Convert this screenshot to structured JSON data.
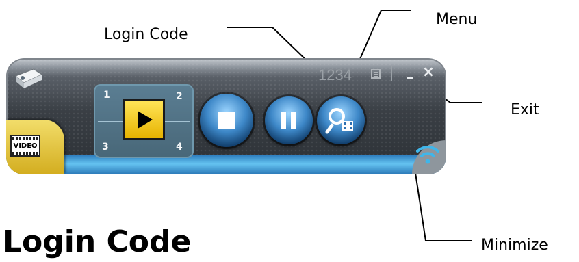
{
  "callouts": {
    "login_code": "Login Code",
    "menu": "Menu",
    "exit": "Exit",
    "minimize": "Minimize"
  },
  "heading": "y Login Code",
  "toolbar": {
    "login_code_value": "1234",
    "video_tab_label": "VIDEO",
    "grid_numbers": [
      "1",
      "2",
      "3",
      "4"
    ]
  },
  "colors": {
    "accent_yellow": "#f0c419",
    "button_blue": "#3d87c7",
    "body_dark": "#2b3035"
  },
  "icons": {
    "projector": "projector-icon",
    "menu": "menu-icon",
    "minimize": "minimize-icon",
    "close": "close-icon",
    "play": "play-icon",
    "stop": "stop-icon",
    "pause": "pause-icon",
    "search": "search-icon",
    "wifi": "wifi-icon"
  }
}
